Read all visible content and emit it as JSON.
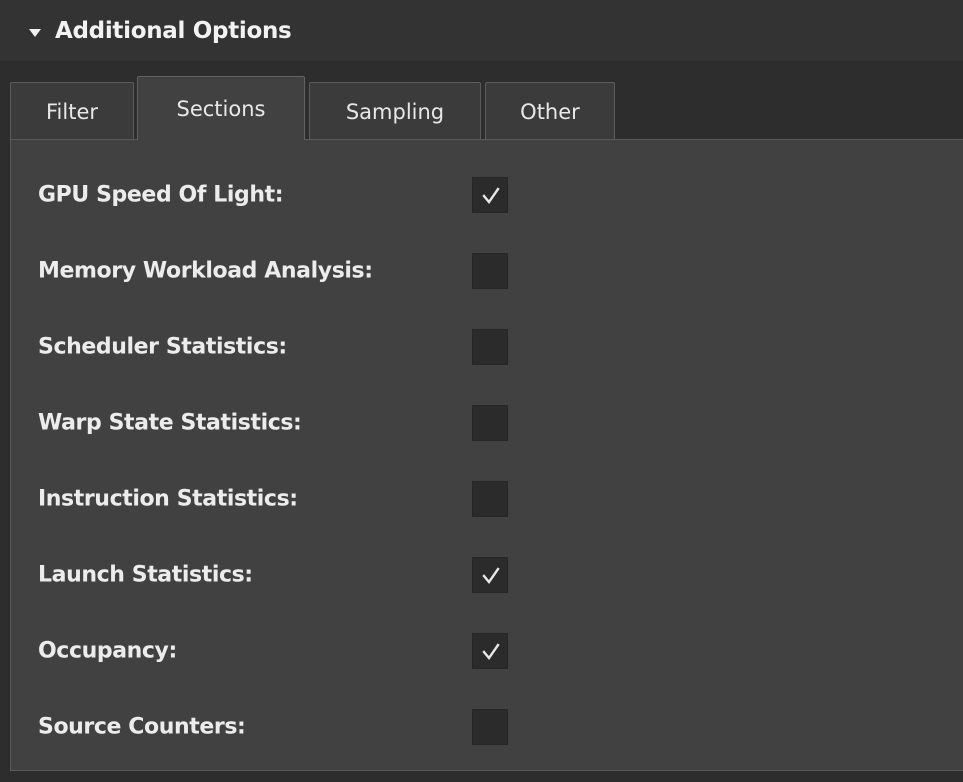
{
  "panel": {
    "title": "Additional Options",
    "expanded": true
  },
  "tabs": [
    {
      "label": "Filter",
      "active": false
    },
    {
      "label": "Sections",
      "active": true
    },
    {
      "label": "Sampling",
      "active": false
    },
    {
      "label": "Other",
      "active": false
    }
  ],
  "sections": [
    {
      "label": "GPU Speed Of Light:",
      "checked": true
    },
    {
      "label": "Memory Workload Analysis:",
      "checked": false
    },
    {
      "label": "Scheduler Statistics:",
      "checked": false
    },
    {
      "label": "Warp State Statistics:",
      "checked": false
    },
    {
      "label": "Instruction Statistics:",
      "checked": false
    },
    {
      "label": "Launch Statistics:",
      "checked": true
    },
    {
      "label": "Occupancy:",
      "checked": true
    },
    {
      "label": "Source Counters:",
      "checked": false
    }
  ],
  "icons": {
    "collapse": "triangle-down-icon",
    "check": "checkmark-icon"
  },
  "colors": {
    "background": "#414141",
    "header": "#333333",
    "checkbox": "#2b2b2b",
    "text": "#ececec"
  }
}
